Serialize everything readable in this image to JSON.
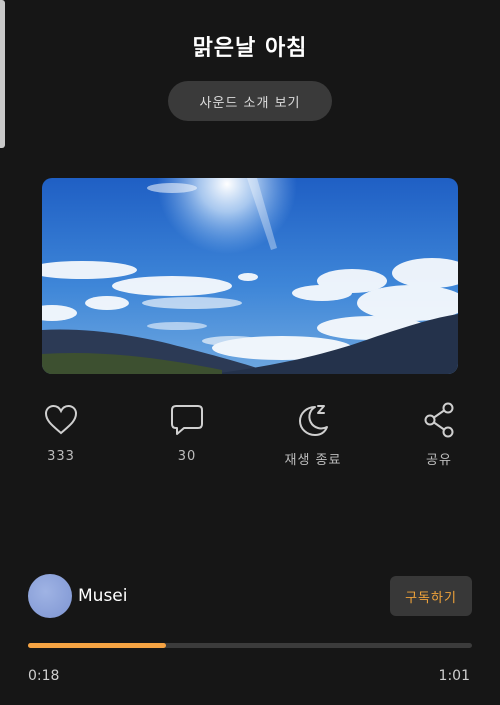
{
  "title": "맑은날 아침",
  "sound_intro_button": "사운드 소개 보기",
  "cover_image": "blue sky with clouds over mountains",
  "actions": [
    {
      "icon": "heart-icon",
      "label": "333"
    },
    {
      "icon": "comment-icon",
      "label": "30"
    },
    {
      "icon": "sleep-moon-icon",
      "label": "재생 종료"
    },
    {
      "icon": "share-icon",
      "label": "공유"
    }
  ],
  "channel": {
    "name": "Musei",
    "subscribe_label": "구독하기"
  },
  "player": {
    "current_time": "0:18",
    "total_time": "1:01",
    "progress": 0.31
  },
  "colors": {
    "accent": "#f5a343",
    "background": "#161616",
    "avatar": "#8fa4dc"
  }
}
